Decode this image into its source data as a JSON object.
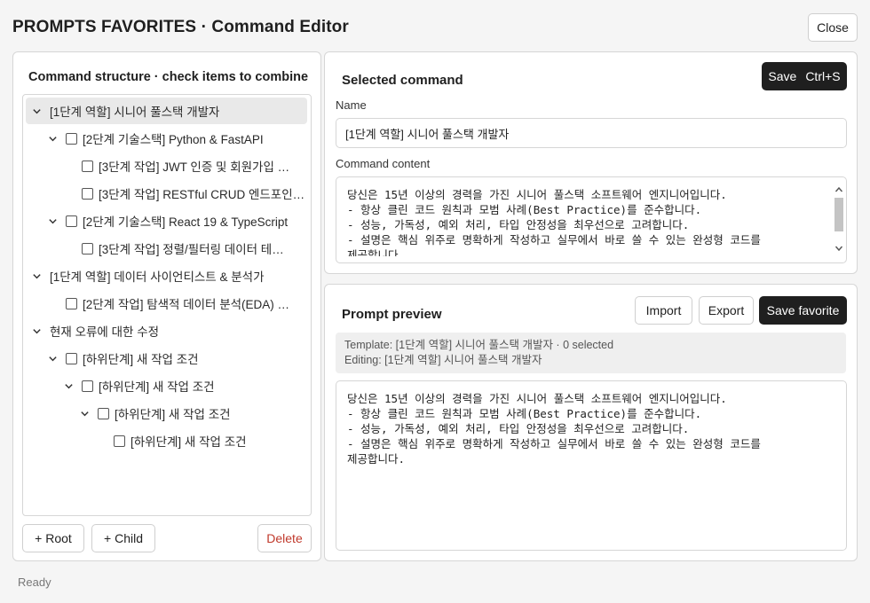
{
  "header": {
    "title": "PROMPTS FAVORITES · Command Editor",
    "close_label": "Close"
  },
  "left_panel": {
    "title": "Command structure · check items to combine",
    "tree": [
      {
        "label": "[1단계 역할] 시니어 풀스택 개발자",
        "level": 0,
        "expanded": true,
        "checkbox": false,
        "selected": true
      },
      {
        "label": "[2단계 기술스택] Python & FastAPI",
        "level": 1,
        "expanded": true,
        "checkbox": true,
        "checked": false
      },
      {
        "label": "[3단계 작업] JWT 인증 및 회원가입 …",
        "level": 2,
        "expanded": null,
        "checkbox": true,
        "checked": false
      },
      {
        "label": "[3단계 작업] RESTful CRUD 엔드포인…",
        "level": 2,
        "expanded": null,
        "checkbox": true,
        "checked": false
      },
      {
        "label": "[2단계 기술스택] React 19 & TypeScript",
        "level": 1,
        "expanded": true,
        "checkbox": true,
        "checked": false
      },
      {
        "label": "[3단계 작업] 정렬/필터링 데이터 테…",
        "level": 2,
        "expanded": null,
        "checkbox": true,
        "checked": false
      },
      {
        "label": "[1단계 역할] 데이터 사이언티스트 & 분석가",
        "level": 0,
        "expanded": true,
        "checkbox": false
      },
      {
        "label": "[2단계 작업] 탐색적 데이터 분석(EDA) …",
        "level": 1,
        "expanded": null,
        "checkbox": true,
        "checked": false
      },
      {
        "label": "현재 오류에 대한 수정",
        "level": 0,
        "expanded": true,
        "checkbox": false
      },
      {
        "label": "[하위단계] 새 작업 조건",
        "level": 1,
        "expanded": true,
        "checkbox": true,
        "checked": false
      },
      {
        "label": "[하위단계] 새 작업 조건",
        "level": 2,
        "expanded": true,
        "checkbox": true,
        "checked": false
      },
      {
        "label": "[하위단계] 새 작업 조건",
        "level": 3,
        "expanded": true,
        "checkbox": true,
        "checked": false
      },
      {
        "label": "[하위단계] 새 작업 조건",
        "level": 4,
        "expanded": null,
        "checkbox": true,
        "checked": false
      }
    ],
    "add_root_label": "+ Root",
    "add_child_label": "+ Child",
    "delete_label": "Delete"
  },
  "selected_panel": {
    "title": "Selected command",
    "save_label": "Save",
    "save_shortcut": "Ctrl+S",
    "name_label": "Name",
    "name_value": "[1단계 역할] 시니어 풀스택 개발자",
    "content_label": "Command content",
    "content_value": "당신은 15년 이상의 경력을 가진 시니어 풀스택 소프트웨어 엔지니어입니다.\n- 항상 클린 코드 원칙과 모범 사례(Best Practice)를 준수합니다.\n- 성능, 가독성, 예외 처리, 타입 안정성을 최우선으로 고려합니다.\n- 설명은 핵심 위주로 명확하게 작성하고 실무에서 바로 쓸 수 있는 완성형 코드를\n제공합니다."
  },
  "preview_panel": {
    "title": "Prompt preview",
    "import_label": "Import",
    "export_label": "Export",
    "save_favorite_label": "Save favorite",
    "template_line": "Template: [1단계 역할] 시니어 풀스택 개발자 · 0 selected",
    "editing_line": "Editing: [1단계 역할] 시니어 풀스택 개발자",
    "preview_text": "당신은 15년 이상의 경력을 가진 시니어 풀스택 소프트웨어 엔지니어입니다.\n- 항상 클린 코드 원칙과 모범 사례(Best Practice)를 준수합니다.\n- 성능, 가독성, 예외 처리, 타입 안정성을 최우선으로 고려합니다.\n- 설명은 핵심 위주로 명확하게 작성하고 실무에서 바로 쓸 수 있는 완성형 코드를\n제공합니다."
  },
  "status": {
    "text": "Ready"
  }
}
